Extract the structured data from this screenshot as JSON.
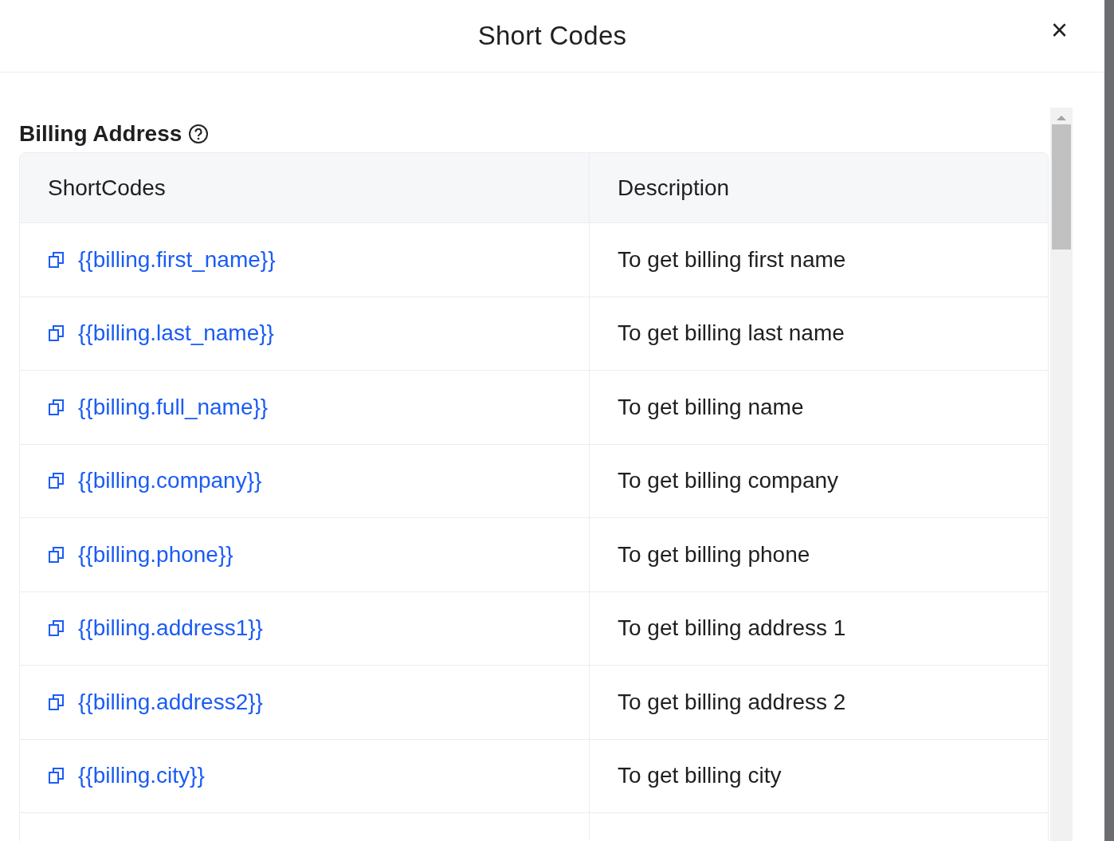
{
  "dialog": {
    "title": "Short Codes",
    "close": "×"
  },
  "section": {
    "title": "Billing Address"
  },
  "table": {
    "columns": [
      "ShortCodes",
      "Description"
    ],
    "rows": [
      {
        "code": "{{billing.first_name}}",
        "description": "To get billing first name"
      },
      {
        "code": "{{billing.last_name}}",
        "description": "To get billing last name"
      },
      {
        "code": "{{billing.full_name}}",
        "description": "To get billing name"
      },
      {
        "code": "{{billing.company}}",
        "description": "To get billing company"
      },
      {
        "code": "{{billing.phone}}",
        "description": "To get billing phone"
      },
      {
        "code": "{{billing.address1}}",
        "description": "To get billing address 1"
      },
      {
        "code": "{{billing.address2}}",
        "description": "To get billing address 2"
      },
      {
        "code": "{{billing.city}}",
        "description": "To get billing city"
      }
    ]
  }
}
